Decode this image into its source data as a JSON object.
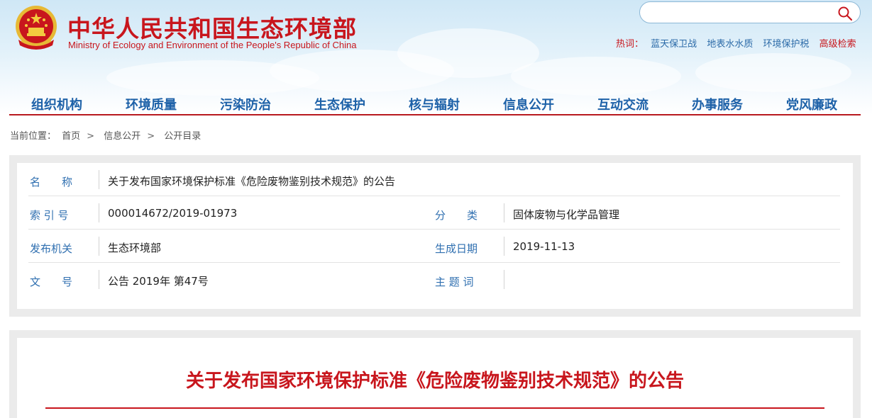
{
  "header": {
    "title": "中华人民共和国生态环境部",
    "subtitle": "Ministry of Ecology and Environment of the People's Republic of China",
    "emblem_icon": "national-emblem-icon"
  },
  "search": {
    "placeholder": "",
    "button_icon": "search-icon"
  },
  "hotwords": {
    "label": "热词：",
    "items": [
      "蓝天保卫战",
      "地表水水质",
      "环境保护税"
    ],
    "advanced": "高级检索"
  },
  "nav": {
    "items": [
      "组织机构",
      "环境质量",
      "污染防治",
      "生态保护",
      "核与辐射",
      "信息公开",
      "互动交流",
      "办事服务",
      "党风廉政"
    ]
  },
  "breadcrumb": {
    "label": "当前位置：",
    "items": [
      "首页",
      "信息公开",
      "公开目录"
    ],
    "separator": ">"
  },
  "info": {
    "name_label": "名　　称",
    "name_value": "关于发布国家环境保护标准《危险废物鉴别技术规范》的公告",
    "index_label": "索 引 号",
    "index_value": "000014672/2019-01973",
    "category_label": "分　　类",
    "category_value": "固体废物与化学品管理",
    "issuer_label": "发布机关",
    "issuer_value": "生态环境部",
    "date_label": "生成日期",
    "date_value": "2019-11-13",
    "docno_label": "文　　号",
    "docno_value": "公告 2019年 第47号",
    "keywords_label": "主 题 词",
    "keywords_value": ""
  },
  "article": {
    "title": "关于发布国家环境保护标准《危险废物鉴别技术规范》的公告"
  },
  "colors": {
    "brand_red": "#c8161d",
    "nav_blue": "#1d61a8",
    "label_blue": "#2f6fb0"
  }
}
